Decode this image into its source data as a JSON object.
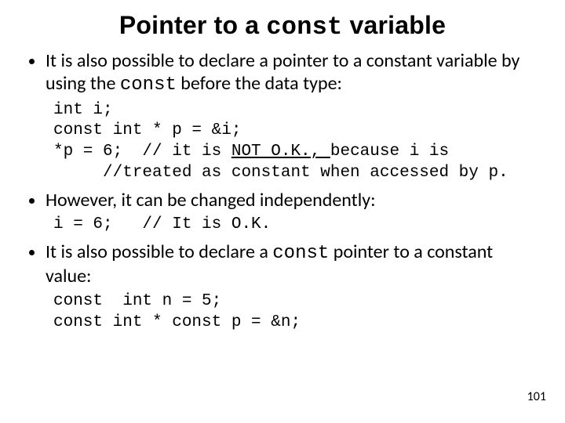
{
  "title": {
    "pre": "Pointer to a ",
    "kw": "const",
    "post": " variable"
  },
  "bullets": {
    "b1": {
      "pre": "It is also possible to declare a pointer to a constant variable by using the ",
      "kw": "const",
      "post": " before the data type:"
    },
    "b2": "However, it can be changed independently:",
    "b3": {
      "pre": "It is also possible to declare a ",
      "kw": "const",
      "post": " pointer to a constant value:"
    }
  },
  "code1": {
    "l1": "int i;",
    "l2": "const int * p = &i;",
    "l3a": "*p = 6;  // it is ",
    "l3u": "NOT O.K., ",
    "l3b": "because i is",
    "l4": "     //treated as constant when accessed by p."
  },
  "code2": "i = 6;   // It is O.K.",
  "code3": {
    "l1": "const  int n = 5;",
    "l2": "const int * const p = &n;"
  },
  "pagenum": "101"
}
